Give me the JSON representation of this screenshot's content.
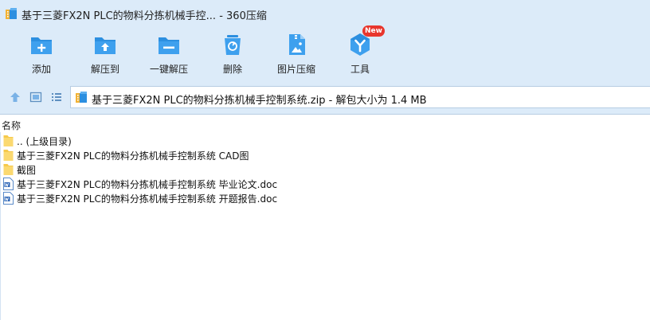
{
  "window": {
    "title": "基于三菱FX2N PLC的物料分拣机械手控... - 360压缩"
  },
  "toolbar": {
    "buttons": [
      {
        "label": "添加",
        "icon": "add-icon"
      },
      {
        "label": "解压到",
        "icon": "extract-to-icon"
      },
      {
        "label": "一键解压",
        "icon": "one-click-extract-icon"
      },
      {
        "label": "删除",
        "icon": "trash-icon"
      },
      {
        "label": "图片压缩",
        "icon": "image-compress-icon"
      },
      {
        "label": "工具",
        "icon": "tools-icon",
        "badge": "New"
      }
    ]
  },
  "addressbar": {
    "path": "基于三菱FX2N PLC的物料分拣机械手控制系统.zip - 解包大小为 1.4 MB"
  },
  "columns": {
    "name": "名称"
  },
  "files": [
    {
      "name": ".. (上级目录)",
      "type": "folder"
    },
    {
      "name": "基于三菱FX2N PLC的物料分拣机械手控制系统 CAD图",
      "type": "folder"
    },
    {
      "name": "截图",
      "type": "folder"
    },
    {
      "name": "基于三菱FX2N PLC的物料分拣机械手控制系统 毕业论文.doc",
      "type": "doc"
    },
    {
      "name": "基于三菱FX2N PLC的物料分拣机械手控制系统 开题报告.doc",
      "type": "doc"
    }
  ],
  "colors": {
    "toolbar_bg": "#dcebf9",
    "icon_blue": "#2c8fe0",
    "folder_yellow": "#f6c94b",
    "badge_red": "#e8362d"
  }
}
